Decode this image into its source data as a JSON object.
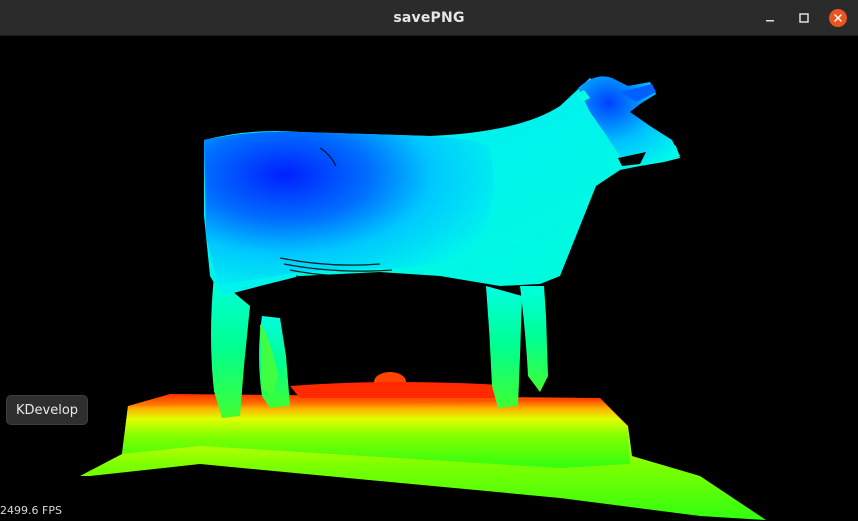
{
  "window": {
    "title": "savePNG",
    "minimize_icon": "minimize-icon",
    "maximize_icon": "maximize-icon",
    "close_icon": "close-icon",
    "close_color": "#e95420"
  },
  "tooltip": {
    "label": "KDevelop"
  },
  "status": {
    "fps": "2499.6 FPS"
  },
  "render": {
    "subject": "cow",
    "colormap": [
      "#0000ff",
      "#00ffff",
      "#00ff00",
      "#ffff00",
      "#ff0000"
    ]
  }
}
